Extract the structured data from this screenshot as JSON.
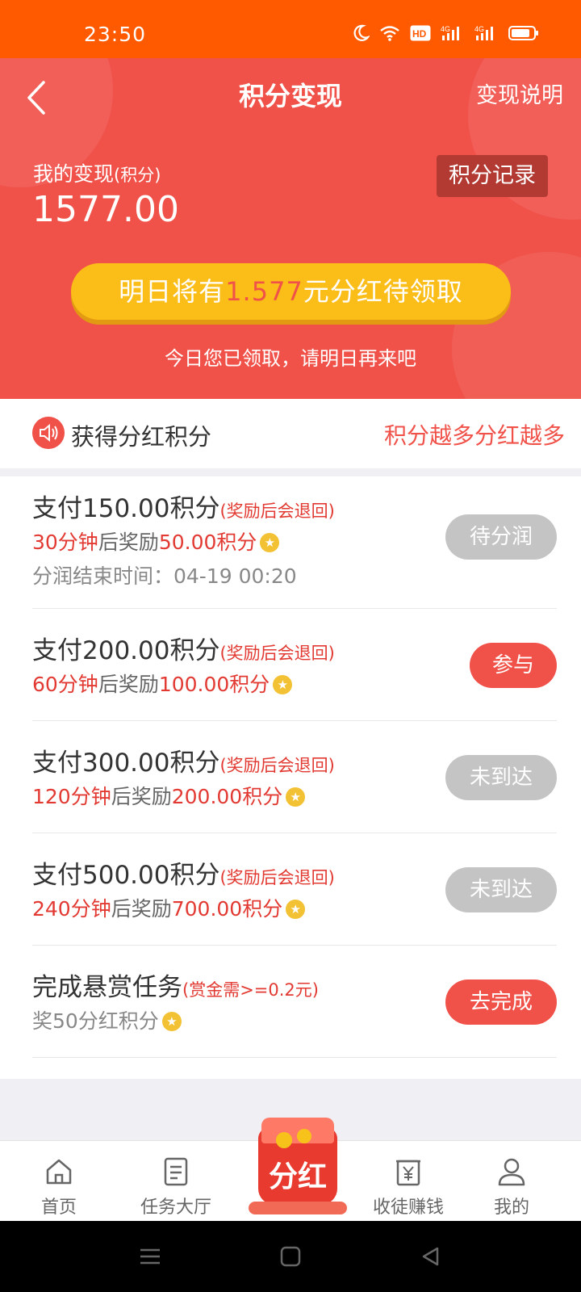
{
  "status_bar": {
    "time": "23:50",
    "icons": [
      "moon-icon",
      "wifi-icon",
      "hd-icon",
      "signal-4g-icon",
      "signal-4g-icon",
      "battery-icon"
    ]
  },
  "header": {
    "title": "积分变现",
    "explain_link": "变现说明",
    "my_label": "我的变现",
    "my_label_unit": "(积分)",
    "amount": "1577.00",
    "record_button": "积分记录",
    "banner_prefix": "明日将有",
    "banner_amount": "1.577",
    "banner_suffix": "元分红待领取",
    "today_note": "今日您已领取，请明日再来吧"
  },
  "notice": {
    "title": "获得分红积分",
    "right_text": "积分越多分红越多"
  },
  "tasks": [
    {
      "title": "支付150.00积分",
      "note": "(奖励后会退回)",
      "time_red": "30分钟",
      "mid": "后奖励",
      "reward_red": "50.00积分",
      "end_time": "分润结束时间：04-19 00:20",
      "action": "待分润"
    },
    {
      "title": "支付200.00积分",
      "note": "(奖励后会退回)",
      "time_red": "60分钟",
      "mid": "后奖励",
      "reward_red": "100.00积分",
      "action": "参与"
    },
    {
      "title": "支付300.00积分",
      "note": "(奖励后会退回)",
      "time_red": "120分钟",
      "mid": "后奖励",
      "reward_red": "200.00积分",
      "action": "未到达"
    },
    {
      "title": "支付500.00积分",
      "note": "(奖励后会退回)",
      "time_red": "240分钟",
      "mid": "后奖励",
      "reward_red": "700.00积分",
      "action": "未到达"
    },
    {
      "title": "完成悬赏任务",
      "note": "(赏金需>=0.2元)",
      "desc": "奖50分红积分",
      "action": "去完成"
    }
  ],
  "tabbar": {
    "home": "首页",
    "tasks": "任务大厅",
    "center": "分红",
    "earn": "收徒赚钱",
    "mine": "我的"
  },
  "colors": {
    "status_bar": "#ff5a00",
    "header": "#f0524a",
    "banner": "#fbbd17",
    "accent_red": "#e23a32",
    "disabled": "#c4c4c4"
  }
}
